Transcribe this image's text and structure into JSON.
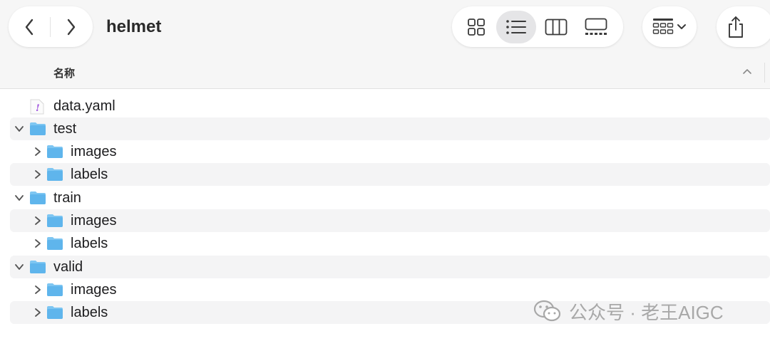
{
  "window": {
    "title": "helmet",
    "navigation": {
      "back_icon": "chevron-left-icon",
      "forward_icon": "chevron-right-icon"
    },
    "view_modes": [
      {
        "name": "icons",
        "icon": "grid-icon",
        "selected": false
      },
      {
        "name": "list",
        "icon": "list-icon",
        "selected": true
      },
      {
        "name": "columns",
        "icon": "columns-icon",
        "selected": false
      },
      {
        "name": "gallery",
        "icon": "gallery-icon",
        "selected": false
      }
    ],
    "group_icon": "group-grid-icon",
    "share_icon": "share-icon"
  },
  "list_header": {
    "name_column": "名称",
    "sort_direction": "ascending"
  },
  "files": [
    {
      "label": "data.yaml",
      "kind": "file",
      "expanded": null
    },
    {
      "label": "test",
      "kind": "folder",
      "expanded": true
    },
    {
      "label": "images",
      "kind": "folder",
      "expanded": false
    },
    {
      "label": "labels",
      "kind": "folder",
      "expanded": false
    },
    {
      "label": "train",
      "kind": "folder",
      "expanded": true
    },
    {
      "label": "images",
      "kind": "folder",
      "expanded": false
    },
    {
      "label": "labels",
      "kind": "folder",
      "expanded": false
    },
    {
      "label": "valid",
      "kind": "folder",
      "expanded": true
    },
    {
      "label": "images",
      "kind": "folder",
      "expanded": false
    },
    {
      "label": "labels",
      "kind": "folder",
      "expanded": false
    }
  ],
  "watermark": {
    "text": "公众号 · 老王AIGC",
    "icon": "wechat-icon"
  },
  "colors": {
    "folder": "#5fb5ec",
    "folder_tab": "#7ec6f2",
    "selection": "#e5e5e7",
    "row_stripe": "#f4f4f5"
  }
}
